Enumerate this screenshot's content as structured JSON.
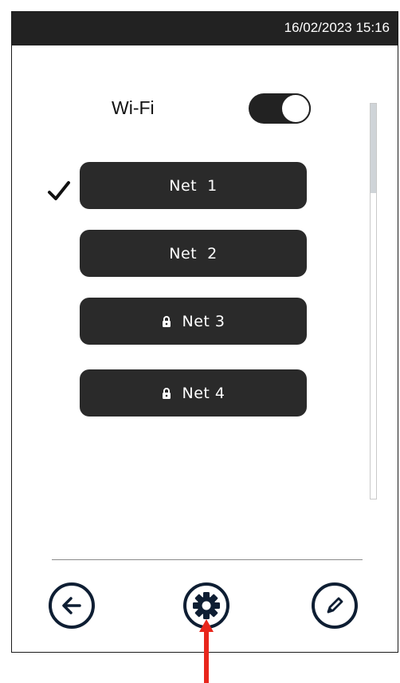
{
  "status_bar": {
    "datetime": "16/02/2023 15:16"
  },
  "wifi": {
    "label": "Wi-Fi",
    "enabled": true
  },
  "networks": [
    {
      "label": "Net  1",
      "locked": false,
      "connected": true
    },
    {
      "label": "Net  2",
      "locked": false,
      "connected": false
    },
    {
      "label": "Net 3",
      "locked": true,
      "connected": false
    },
    {
      "label": "Net 4",
      "locked": true,
      "connected": false
    }
  ],
  "bottom_nav": {
    "back_icon": "arrow-left-icon",
    "settings_icon": "gear-icon",
    "edit_icon": "pencil-icon"
  },
  "colors": {
    "dark": "#222222",
    "nav_stroke": "#0e1e33",
    "highlight_arrow": "#e8261c"
  }
}
